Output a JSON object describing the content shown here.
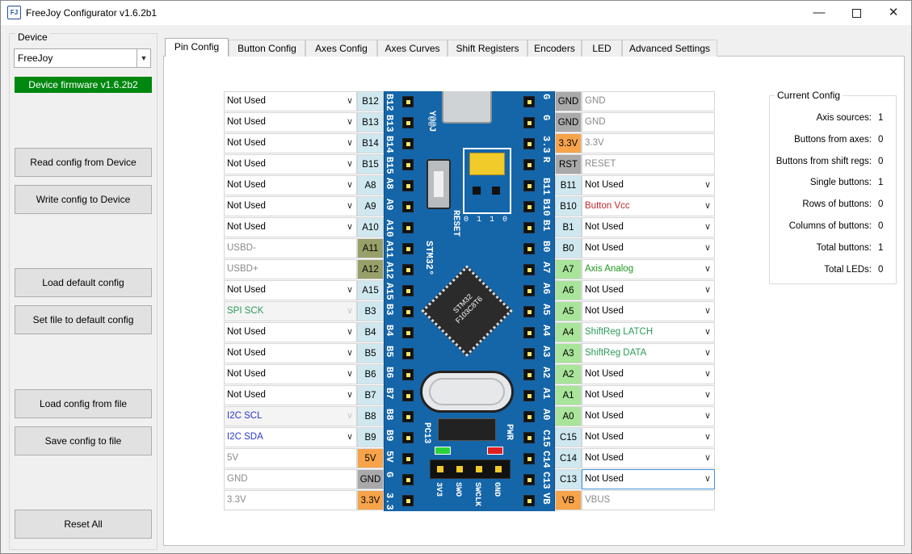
{
  "window": {
    "title": "FreeJoy Configurator v1.6.2b1",
    "icon_text": "FJ"
  },
  "device": {
    "group_label": "Device",
    "selected": "FreeJoy",
    "firmware": "Device firmware v1.6.2b2",
    "firmware_color": "#00870f"
  },
  "buttons": {
    "read": "Read config from Device",
    "write": "Write config to Device",
    "load_default": "Load default config",
    "set_default": "Set file to default config",
    "load_file": "Load config from file",
    "save_file": "Save config to file",
    "reset": "Reset All"
  },
  "tabs": [
    "Pin Config",
    "Button Config",
    "Axes Config",
    "Axes Curves",
    "Shift Registers",
    "Encoders",
    "LED",
    "Advanced Settings"
  ],
  "left_pins": [
    {
      "pin": "B12",
      "value": "Not Used",
      "kind": "combo",
      "pin_color": "#cfe8f0",
      "text_color": "#000000"
    },
    {
      "pin": "B13",
      "value": "Not Used",
      "kind": "combo",
      "pin_color": "#cfe8f0",
      "text_color": "#000000"
    },
    {
      "pin": "B14",
      "value": "Not Used",
      "kind": "combo",
      "pin_color": "#cfe8f0",
      "text_color": "#000000"
    },
    {
      "pin": "B15",
      "value": "Not Used",
      "kind": "combo",
      "pin_color": "#cfe8f0",
      "text_color": "#000000"
    },
    {
      "pin": "A8",
      "value": "Not Used",
      "kind": "combo",
      "pin_color": "#cfe8f0",
      "text_color": "#000000"
    },
    {
      "pin": "A9",
      "value": "Not Used",
      "kind": "combo",
      "pin_color": "#cfe8f0",
      "text_color": "#000000"
    },
    {
      "pin": "A10",
      "value": "Not Used",
      "kind": "combo",
      "pin_color": "#cfe8f0",
      "text_color": "#000000"
    },
    {
      "pin": "A11",
      "value": "USBD-",
      "kind": "text",
      "pin_color": "#98a06a",
      "text_color": "#8a8a8a"
    },
    {
      "pin": "A12",
      "value": "USBD+",
      "kind": "text",
      "pin_color": "#98a06a",
      "text_color": "#8a8a8a"
    },
    {
      "pin": "A15",
      "value": "Not Used",
      "kind": "combo",
      "pin_color": "#cfe8f0",
      "text_color": "#000000"
    },
    {
      "pin": "B3",
      "value": "SPI SCK",
      "kind": "combo-disabled",
      "pin_color": "#cfe8f0",
      "text_color": "#2a9a58"
    },
    {
      "pin": "B4",
      "value": "Not Used",
      "kind": "combo",
      "pin_color": "#cfe8f0",
      "text_color": "#000000"
    },
    {
      "pin": "B5",
      "value": "Not Used",
      "kind": "combo",
      "pin_color": "#cfe8f0",
      "text_color": "#000000"
    },
    {
      "pin": "B6",
      "value": "Not Used",
      "kind": "combo",
      "pin_color": "#cfe8f0",
      "text_color": "#000000"
    },
    {
      "pin": "B7",
      "value": "Not Used",
      "kind": "combo",
      "pin_color": "#cfe8f0",
      "text_color": "#000000"
    },
    {
      "pin": "B8",
      "value": "I2C SCL",
      "kind": "combo-disabled",
      "pin_color": "#cfe8f0",
      "text_color": "#2a38c8"
    },
    {
      "pin": "B9",
      "value": "I2C SDA",
      "kind": "combo",
      "pin_color": "#cfe8f0",
      "text_color": "#2a38c8"
    },
    {
      "pin": "5V",
      "value": "5V",
      "kind": "text",
      "pin_color": "#f7a34a",
      "text_color": "#8a8a8a"
    },
    {
      "pin": "GND",
      "value": "GND",
      "kind": "text",
      "pin_color": "#a9a9a9",
      "text_color": "#8a8a8a"
    },
    {
      "pin": "3.3V",
      "value": "3.3V",
      "kind": "text",
      "pin_color": "#f7a34a",
      "text_color": "#8a8a8a"
    }
  ],
  "right_pins": [
    {
      "pin": "GND",
      "value": "GND",
      "kind": "text",
      "pin_color": "#a9a9a9",
      "text_color": "#8a8a8a"
    },
    {
      "pin": "GND",
      "value": "GND",
      "kind": "text",
      "pin_color": "#a9a9a9",
      "text_color": "#8a8a8a"
    },
    {
      "pin": "3.3V",
      "value": "3.3V",
      "kind": "text",
      "pin_color": "#f7a34a",
      "text_color": "#8a8a8a"
    },
    {
      "pin": "RST",
      "value": "RESET",
      "kind": "text",
      "pin_color": "#a9a9a9",
      "text_color": "#8a8a8a"
    },
    {
      "pin": "B11",
      "value": "Not Used",
      "kind": "combo",
      "pin_color": "#cfe8f0",
      "text_color": "#000000"
    },
    {
      "pin": "B10",
      "value": "Button Vcc",
      "kind": "combo",
      "pin_color": "#cfe8f0",
      "text_color": "#c0262d"
    },
    {
      "pin": "B1",
      "value": "Not Used",
      "kind": "combo",
      "pin_color": "#cfe8f0",
      "text_color": "#000000"
    },
    {
      "pin": "B0",
      "value": "Not Used",
      "kind": "combo",
      "pin_color": "#cfe8f0",
      "text_color": "#000000"
    },
    {
      "pin": "A7",
      "value": "Axis Analog",
      "kind": "combo",
      "pin_color": "#a8e59a",
      "text_color": "#1a9a1a"
    },
    {
      "pin": "A6",
      "value": "Not Used",
      "kind": "combo",
      "pin_color": "#a8e59a",
      "text_color": "#000000"
    },
    {
      "pin": "A5",
      "value": "Not Used",
      "kind": "combo",
      "pin_color": "#a8e59a",
      "text_color": "#000000"
    },
    {
      "pin": "A4",
      "value": "ShiftReg LATCH",
      "kind": "combo",
      "pin_color": "#a8e59a",
      "text_color": "#2a9a58"
    },
    {
      "pin": "A3",
      "value": "ShiftReg DATA",
      "kind": "combo",
      "pin_color": "#a8e59a",
      "text_color": "#2a9a58"
    },
    {
      "pin": "A2",
      "value": "Not Used",
      "kind": "combo",
      "pin_color": "#a8e59a",
      "text_color": "#000000"
    },
    {
      "pin": "A1",
      "value": "Not Used",
      "kind": "combo",
      "pin_color": "#a8e59a",
      "text_color": "#000000"
    },
    {
      "pin": "A0",
      "value": "Not Used",
      "kind": "combo",
      "pin_color": "#a8e59a",
      "text_color": "#000000"
    },
    {
      "pin": "C15",
      "value": "Not Used",
      "kind": "combo",
      "pin_color": "#cfe8f0",
      "text_color": "#000000"
    },
    {
      "pin": "C14",
      "value": "Not Used",
      "kind": "combo",
      "pin_color": "#cfe8f0",
      "text_color": "#000000"
    },
    {
      "pin": "C13",
      "value": "Not Used",
      "kind": "combo-focused",
      "pin_color": "#cfe8f0",
      "text_color": "#000000"
    },
    {
      "pin": "VB",
      "value": "VBUS",
      "kind": "text",
      "pin_color": "#f7a34a",
      "text_color": "#8a8a8a"
    }
  ],
  "board": {
    "left_silk": [
      "B12",
      "B13",
      "B14",
      "B15",
      "A8",
      "A9",
      "A10",
      "A11",
      "A12",
      "A15",
      "B3",
      "B4",
      "B5",
      "B6",
      "B7",
      "B8",
      "B9",
      "5V",
      "G",
      "3.3"
    ],
    "right_silk": [
      "G",
      "G",
      "3.3",
      "R",
      "B11",
      "B10",
      "B1",
      "B0",
      "A7",
      "A6",
      "A5",
      "A4",
      "A3",
      "A2",
      "A1",
      "A0",
      "C15",
      "C14",
      "C13",
      "VB"
    ],
    "reset_label": "RESET",
    "stm_label": "STM32°",
    "chip_label": "STM32 F103C8T6",
    "brand_label": "Y@@J",
    "pc13_label": "PC13",
    "pwr_label": "PWR",
    "jumper_marks": [
      "0",
      "1",
      "1",
      "0"
    ],
    "swd_labels": [
      "3V3",
      "SWO",
      "SWCLK",
      "GND"
    ]
  },
  "current_config": {
    "title": "Current Config",
    "rows": [
      {
        "label": "Axis sources:",
        "value": "1"
      },
      {
        "label": "Buttons from axes:",
        "value": "0"
      },
      {
        "label": "Buttons from shift regs:",
        "value": "0"
      },
      {
        "label": "Single buttons:",
        "value": "1"
      },
      {
        "label": "Rows of buttons:",
        "value": "0"
      },
      {
        "label": "Columns of buttons:",
        "value": "0"
      },
      {
        "label": "Total buttons:",
        "value": "1"
      },
      {
        "label": "Total LEDs:",
        "value": "0"
      }
    ]
  }
}
